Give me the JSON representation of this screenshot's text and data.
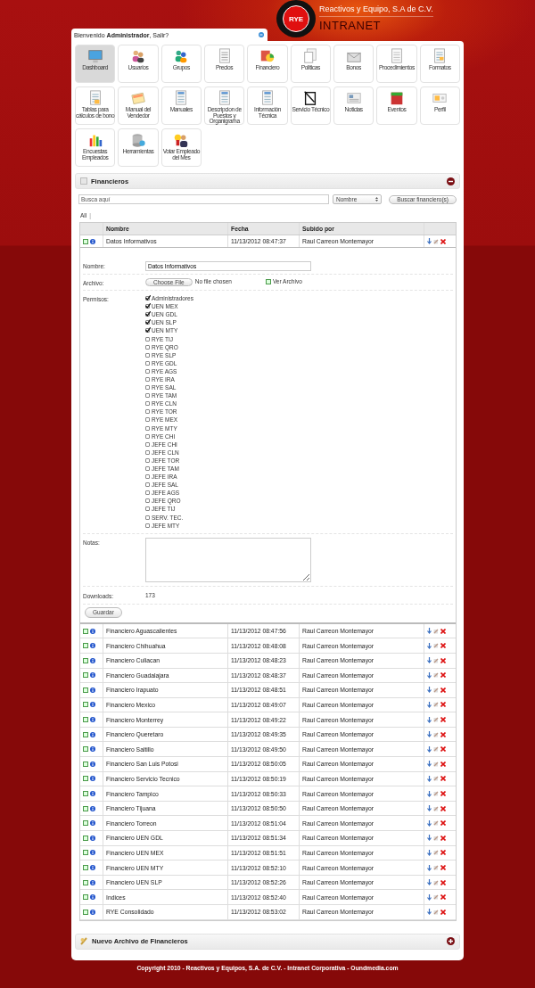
{
  "header": {
    "logo_text": "RYE",
    "company": "Reactivos y Equipo, S.A de C.V.",
    "title": "INTRANET"
  },
  "welcome": "Bienvenido **Administrador**, Salir?",
  "nav": [
    {
      "label": "Dashboard",
      "selected": true
    },
    {
      "label": "Usuarios",
      "selected": false
    },
    {
      "label": "Grupos",
      "selected": false
    },
    {
      "label": "Precios",
      "selected": false
    },
    {
      "label": "Financiero",
      "selected": false
    },
    {
      "label": "Politicas",
      "selected": false
    },
    {
      "label": "Bonos",
      "selected": false
    },
    {
      "label": "Procedimientos",
      "selected": false
    },
    {
      "label": "Formatos",
      "selected": false
    },
    {
      "label": "Tablas para cálculos de bono",
      "selected": false
    },
    {
      "label": "Manual del Vendedor",
      "selected": false
    },
    {
      "label": "Manuales",
      "selected": false
    },
    {
      "label": "Descripcion de Puestos y Organigrama",
      "selected": false
    },
    {
      "label": "Información Técnica",
      "selected": false
    },
    {
      "label": "Servicio Técnico",
      "selected": false
    },
    {
      "label": "Noticias",
      "selected": false
    },
    {
      "label": "Eventos",
      "selected": false
    },
    {
      "label": "Perfil",
      "selected": false
    },
    {
      "label": "Encuestas Empleados",
      "selected": false
    },
    {
      "label": "Herramientas",
      "selected": false
    },
    {
      "label": "Votar Empleado del Mes",
      "selected": false
    }
  ],
  "section": {
    "title": "Financieros",
    "expanded": true
  },
  "search": {
    "placeholder": "Busca aquí",
    "filter": "Nombre",
    "button": "Buscar financiero(s)"
  },
  "letter_filter": {
    "all": "All",
    "separator": "|"
  },
  "table": {
    "columns": [
      "Nombre",
      "Fecha",
      "Subido por"
    ],
    "rows": [
      {
        "name": "Datos Informativos",
        "date": "11/13/2012 08:47:37",
        "user": "Raul Carreon Montemayor",
        "expanded": true
      },
      {
        "name": "Financiero Aguascalientes",
        "date": "11/13/2012 08:47:56",
        "user": "Raul Carreon Montemayor",
        "expanded": false
      },
      {
        "name": "Financiero Chihuahua",
        "date": "11/13/2012 08:48:08",
        "user": "Raul Carreon Montemayor",
        "expanded": false
      },
      {
        "name": "Financiero Culiacan",
        "date": "11/13/2012 08:48:23",
        "user": "Raul Carreon Montemayor",
        "expanded": false
      },
      {
        "name": "Financiero Guadalajara",
        "date": "11/13/2012 08:48:37",
        "user": "Raul Carreon Montemayor",
        "expanded": false
      },
      {
        "name": "Financiero Irapuato",
        "date": "11/13/2012 08:48:51",
        "user": "Raul Carreon Montemayor",
        "expanded": false
      },
      {
        "name": "Financiero Mexico",
        "date": "11/13/2012 08:49:07",
        "user": "Raul Carreon Montemayor",
        "expanded": false
      },
      {
        "name": "Financiero Monterrey",
        "date": "11/13/2012 08:49:22",
        "user": "Raul Carreon Montemayor",
        "expanded": false
      },
      {
        "name": "Financiero Queretaro",
        "date": "11/13/2012 08:49:35",
        "user": "Raul Carreon Montemayor",
        "expanded": false
      },
      {
        "name": "Financiero Saltillo",
        "date": "11/13/2012 08:49:50",
        "user": "Raul Carreon Montemayor",
        "expanded": false
      },
      {
        "name": "Financiero San Luis Potosi",
        "date": "11/13/2012 08:50:05",
        "user": "Raul Carreon Montemayor",
        "expanded": false
      },
      {
        "name": "Financiero Servicio Tecnico",
        "date": "11/13/2012 08:50:19",
        "user": "Raul Carreon Montemayor",
        "expanded": false
      },
      {
        "name": "Financiero Tampico",
        "date": "11/13/2012 08:50:33",
        "user": "Raul Carreon Montemayor",
        "expanded": false
      },
      {
        "name": "Financiero Tijuana",
        "date": "11/13/2012 08:50:50",
        "user": "Raul Carreon Montemayor",
        "expanded": false
      },
      {
        "name": "Financiero Torreon",
        "date": "11/13/2012 08:51:04",
        "user": "Raul Carreon Montemayor",
        "expanded": false
      },
      {
        "name": "Financiero UEN GDL",
        "date": "11/13/2012 08:51:34",
        "user": "Raul Carreon Montemayor",
        "expanded": false
      },
      {
        "name": "Financiero UEN MEX",
        "date": "11/13/2012 08:51:51",
        "user": "Raul Carreon Montemayor",
        "expanded": false
      },
      {
        "name": "Financiero UEN MTY",
        "date": "11/13/2012 08:52:10",
        "user": "Raul Carreon Montemayor",
        "expanded": false
      },
      {
        "name": "Financiero UEN SLP",
        "date": "11/13/2012 08:52:26",
        "user": "Raul Carreon Montemayor",
        "expanded": false
      },
      {
        "name": "Indices",
        "date": "11/13/2012 08:52:40",
        "user": "Raul Carreon Montemayor",
        "expanded": false
      },
      {
        "name": "RYE Consolidado",
        "date": "11/13/2012 08:53:02",
        "user": "Raul Carreon Montemayor",
        "expanded": false
      }
    ]
  },
  "edit_form": {
    "name": {
      "label": "Nombre:",
      "value": "Datos Informativos"
    },
    "file": {
      "label": "Archivo:",
      "button": "Choose File",
      "status": "No file chosen",
      "link": "Ver Archivo"
    },
    "permissions": {
      "label": "Permisos:",
      "options": [
        {
          "label": "Administradores",
          "checked": true
        },
        {
          "label": "UEN MEX",
          "checked": true
        },
        {
          "label": "UEN GDL",
          "checked": true
        },
        {
          "label": "UEN SLP",
          "checked": true
        },
        {
          "label": "UEN MTY",
          "checked": true
        },
        {
          "label": "RYE TIJ",
          "checked": false
        },
        {
          "label": "RYE QRO",
          "checked": false
        },
        {
          "label": "RYE SLP",
          "checked": false
        },
        {
          "label": "RYE GDL",
          "checked": false
        },
        {
          "label": "RYE AGS",
          "checked": false
        },
        {
          "label": "RYE IRA",
          "checked": false
        },
        {
          "label": "RYE SAL",
          "checked": false
        },
        {
          "label": "RYE TAM",
          "checked": false
        },
        {
          "label": "RYE CLN",
          "checked": false
        },
        {
          "label": "RYE TOR",
          "checked": false
        },
        {
          "label": "RYE MEX",
          "checked": false
        },
        {
          "label": "RYE MTY",
          "checked": false
        },
        {
          "label": "RYE CHI",
          "checked": false
        },
        {
          "label": "JEFE CHI",
          "checked": false
        },
        {
          "label": "JEFE CLN",
          "checked": false
        },
        {
          "label": "JEFE TOR",
          "checked": false
        },
        {
          "label": "JEFE TAM",
          "checked": false
        },
        {
          "label": "JEFE IRA",
          "checked": false
        },
        {
          "label": "JEFE SAL",
          "checked": false
        },
        {
          "label": "JEFE AGS",
          "checked": false
        },
        {
          "label": "JEFE QRO",
          "checked": false
        },
        {
          "label": "JEFE TIJ",
          "checked": false
        },
        {
          "label": "SERV. TEC.",
          "checked": false
        },
        {
          "label": "JEFE MTY",
          "checked": false
        }
      ]
    },
    "notes": {
      "label": "Notas:"
    },
    "downloads": {
      "label": "Downloads:",
      "value": "173"
    },
    "save_button": "Guardar"
  },
  "new_section": {
    "title": "Nuevo Archivo de Financieros",
    "expanded": false
  },
  "footer": "Copyright 2010 - Reactivos y Equipos, S.A. de C.V. - Intranet Corporativa - Oundmedia.com"
}
